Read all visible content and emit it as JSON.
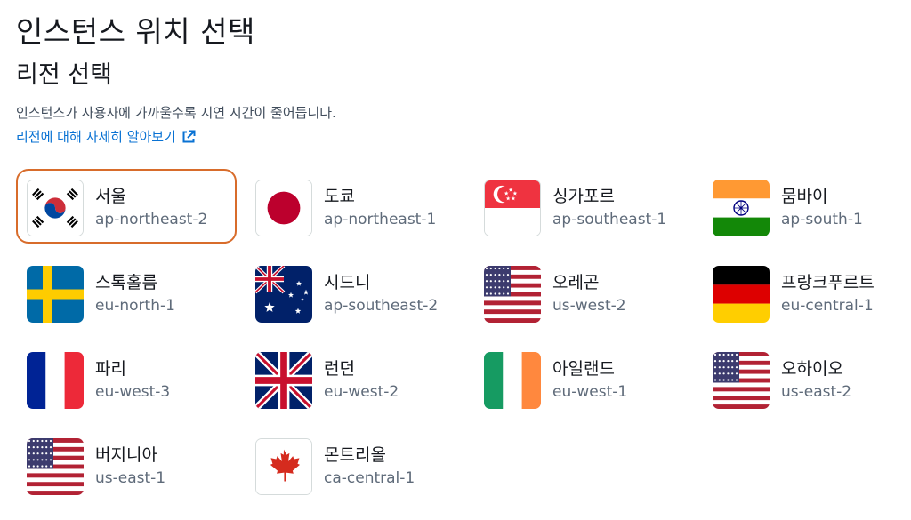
{
  "page": {
    "title": "인스턴스 위치 선택",
    "section_title": "리전 선택",
    "description": "인스턴스가 사용자에 가까울수록 지연 시간이 줄어듭니다.",
    "learn_more_link": "리전에 대해 자세히 알아보기"
  },
  "regions": [
    {
      "name": "서울",
      "code": "ap-northeast-2",
      "flag": "south-korea-flag",
      "selected": true
    },
    {
      "name": "도쿄",
      "code": "ap-northeast-1",
      "flag": "japan-flag",
      "selected": false
    },
    {
      "name": "싱가포르",
      "code": "ap-southeast-1",
      "flag": "singapore-flag",
      "selected": false
    },
    {
      "name": "뭄바이",
      "code": "ap-south-1",
      "flag": "india-flag",
      "selected": false
    },
    {
      "name": "스톡홀름",
      "code": "eu-north-1",
      "flag": "sweden-flag",
      "selected": false
    },
    {
      "name": "시드니",
      "code": "ap-southeast-2",
      "flag": "australia-flag",
      "selected": false
    },
    {
      "name": "오레곤",
      "code": "us-west-2",
      "flag": "usa-flag",
      "selected": false
    },
    {
      "name": "프랑크푸르트",
      "code": "eu-central-1",
      "flag": "germany-flag",
      "selected": false
    },
    {
      "name": "파리",
      "code": "eu-west-3",
      "flag": "france-flag",
      "selected": false
    },
    {
      "name": "런던",
      "code": "eu-west-2",
      "flag": "uk-flag",
      "selected": false
    },
    {
      "name": "아일랜드",
      "code": "eu-west-1",
      "flag": "ireland-flag",
      "selected": false
    },
    {
      "name": "오하이오",
      "code": "us-east-2",
      "flag": "usa-flag",
      "selected": false
    },
    {
      "name": "버지니아",
      "code": "us-east-1",
      "flag": "usa-flag",
      "selected": false
    },
    {
      "name": "몬트리올",
      "code": "ca-central-1",
      "flag": "canada-flag",
      "selected": false
    }
  ],
  "colors": {
    "selected_border": "#d86c2b",
    "link": "#0972d3",
    "secondary_text": "#5f6b7a"
  }
}
